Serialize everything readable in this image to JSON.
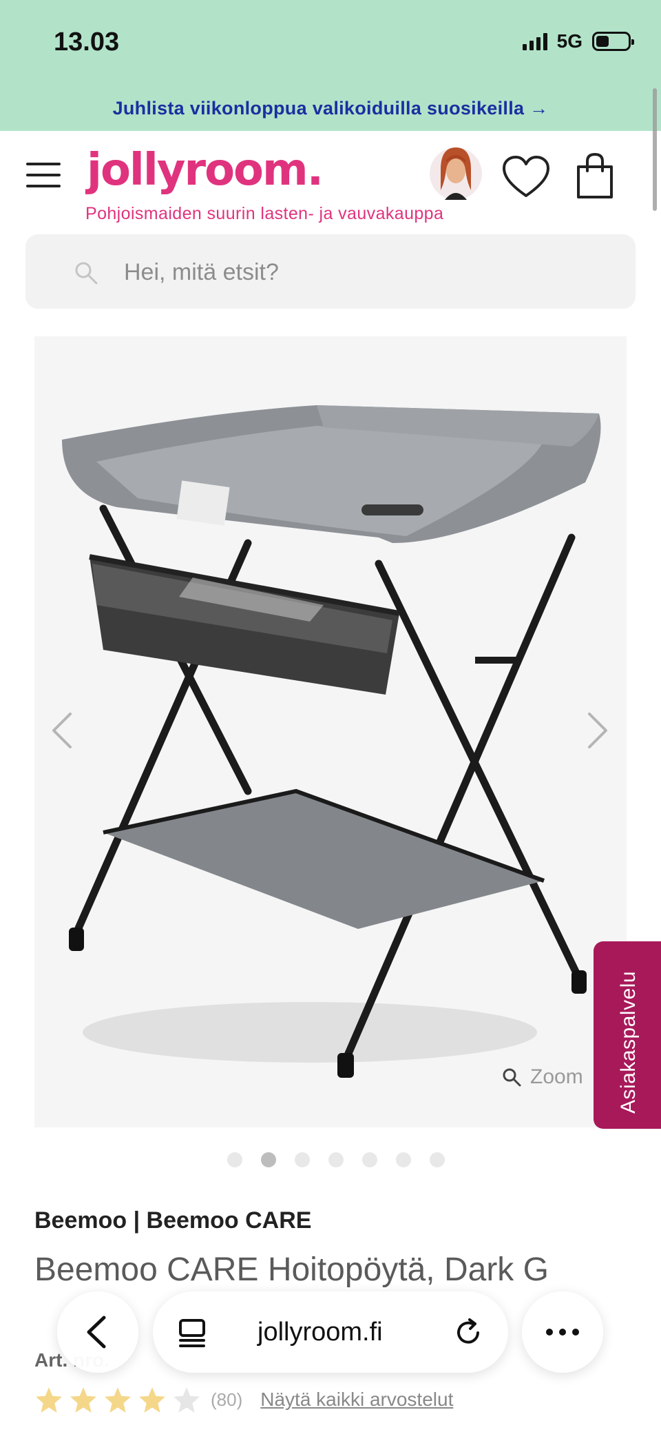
{
  "status_bar": {
    "time": "13.03",
    "network": "5G"
  },
  "promo": {
    "text": "Juhlista viikonloppua valikoiduilla suosikeilla →"
  },
  "header": {
    "logo": "jollyroom.",
    "tagline": "Pohjoismaiden suurin lasten- ja vauvakauppa"
  },
  "search": {
    "placeholder": "Hei, mitä etsit?"
  },
  "gallery": {
    "zoom_label": "Zoom",
    "dot_count": 7,
    "active_index": 1
  },
  "support": {
    "label": "Asiakaspalvelu"
  },
  "product": {
    "brand": "Beemoo | Beemoo CARE",
    "title": "Beemoo CARE Hoitopöytä, Dark G",
    "art_label": "Art. nro.",
    "rating": 4,
    "review_count": "(80)",
    "reviews_link": "Näytä kaikki arvostelut"
  },
  "browser": {
    "url": "jollyroom.fi"
  },
  "colors": {
    "brand_pink": "#e0337e",
    "promo_bg": "#b2e3c9",
    "promo_text": "#1a2fa0",
    "support_bg": "#a8195a",
    "star": "#f5d78a"
  }
}
